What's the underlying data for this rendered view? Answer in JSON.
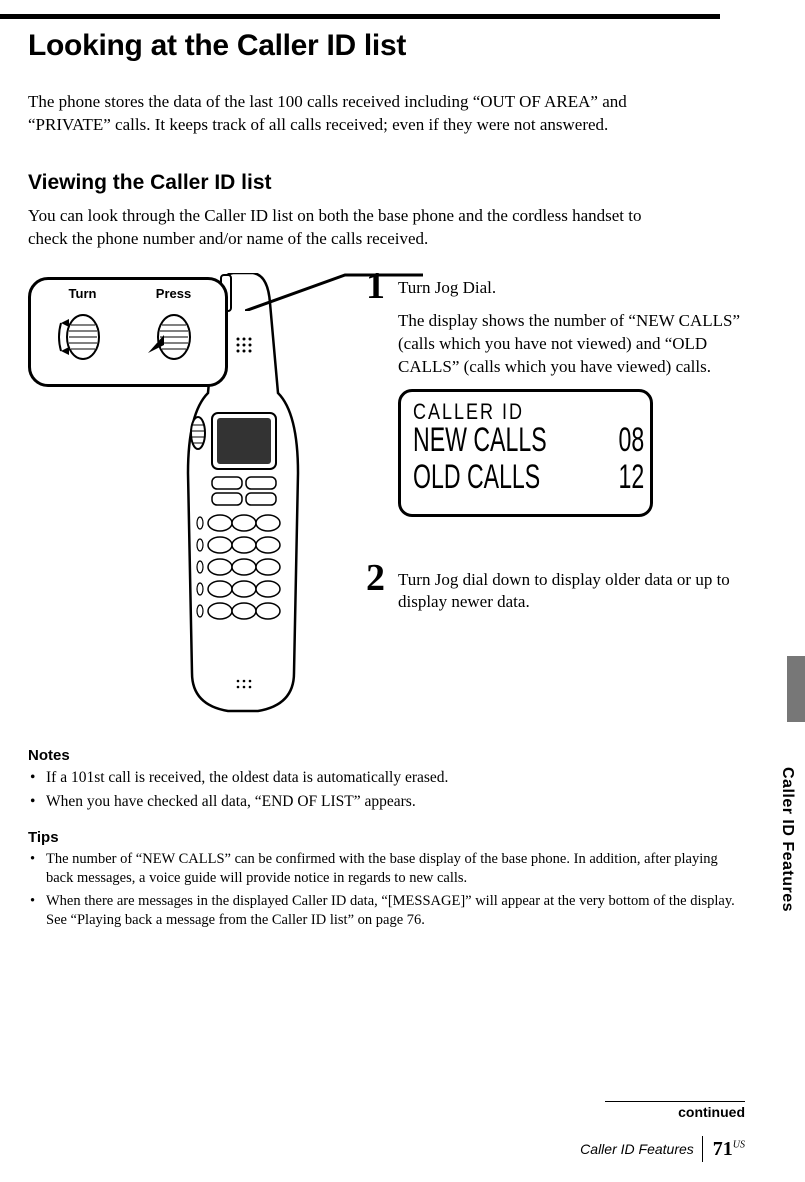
{
  "title": "Looking at the Caller ID list",
  "intro": "The phone stores the data of the last 100 calls received including “OUT OF  AREA” and “PRIVATE” calls. It keeps track of all calls received; even if they were not answered.",
  "sub_heading": "Viewing the Caller ID list",
  "sub_intro": "You can look through the Caller ID list on both the base phone and the cordless handset to check the phone number and/or name of the calls received.",
  "callout": {
    "turn": "Turn",
    "press": "Press"
  },
  "steps": {
    "one": {
      "num": "1",
      "lead": "Turn Jog Dial.",
      "body": "The display shows the number of “NEW  CALLS” (calls which you have not viewed) and “OLD  CALLS” (calls which you have viewed) calls."
    },
    "two": {
      "num": "2",
      "body": "Turn Jog dial down to display older data or up to display newer data."
    }
  },
  "lcd": {
    "header": "CALLER ID",
    "row1_label": "NEW CALLS",
    "row1_val": "08",
    "row2_label": "OLD CALLS",
    "row2_val": "12"
  },
  "notes": {
    "heading": "Notes",
    "items": [
      "If a 101st call is received, the oldest data is automatically erased.",
      "When you have checked all data, “END OF LIST” appears."
    ]
  },
  "tips": {
    "heading": "Tips",
    "items": [
      "The number of “NEW CALLS” can be confirmed with the base display of the base phone. In addition, after playing back messages, a voice guide will provide notice in regards to new calls.",
      "When there are messages in the displayed Caller ID data, “[MESSAGE]” will appear at the very bottom of the display. See “Playing back a message from the Caller ID list” on page 76."
    ]
  },
  "side_tab": "Caller ID Features",
  "continued": "continued",
  "footer": {
    "section": "Caller ID Features",
    "page": "71",
    "sup": "US"
  }
}
